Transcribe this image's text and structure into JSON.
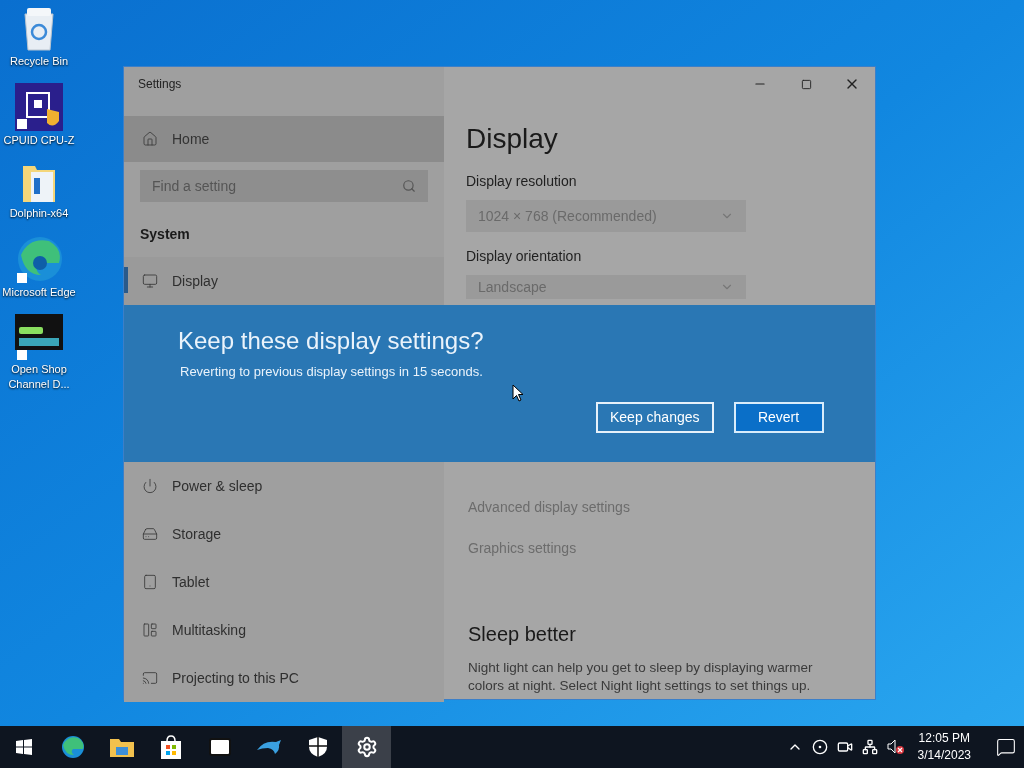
{
  "desktop": {
    "icons": [
      {
        "label": "Recycle Bin"
      },
      {
        "label": "CPUID CPU-Z"
      },
      {
        "label": "Dolphin-x64"
      },
      {
        "label": "Microsoft Edge"
      },
      {
        "label": "Open Shop Channel D..."
      }
    ]
  },
  "window": {
    "title": "Settings",
    "sidebar": {
      "home": "Home",
      "search_placeholder": "Find a setting",
      "section": "System",
      "nav_top": [
        {
          "label": "Display",
          "selected": true
        }
      ],
      "nav_bottom": [
        {
          "label": "Power & sleep",
          "selected": false
        },
        {
          "label": "Storage",
          "selected": false
        },
        {
          "label": "Tablet",
          "selected": false
        },
        {
          "label": "Multitasking",
          "selected": false
        },
        {
          "label": "Projecting to this PC",
          "selected": false
        }
      ]
    },
    "content": {
      "heading": "Display",
      "fields": [
        {
          "label": "Display resolution",
          "value": "1024 × 768 (Recommended)"
        },
        {
          "label": "Display orientation",
          "value": "Landscape"
        }
      ],
      "links": [
        "Advanced display settings",
        "Graphics settings"
      ],
      "section_title": "Sleep better",
      "paragraph": "Night light can help you get to sleep by displaying warmer colors at night. Select Night light settings to set things up."
    }
  },
  "dialog": {
    "title": "Keep these display settings?",
    "message": "Reverting to previous display settings in 15 seconds.",
    "buttons": [
      {
        "label": "Keep changes",
        "kind": "outline"
      },
      {
        "label": "Revert",
        "kind": "primary"
      }
    ]
  },
  "taskbar": {
    "apps": [
      {
        "active": false
      },
      {
        "active": false
      },
      {
        "active": false
      },
      {
        "active": false
      },
      {
        "active": false
      },
      {
        "active": false
      },
      {
        "active": true
      }
    ],
    "clock": {
      "time": "12:05 PM",
      "date": "3/14/2023"
    }
  }
}
